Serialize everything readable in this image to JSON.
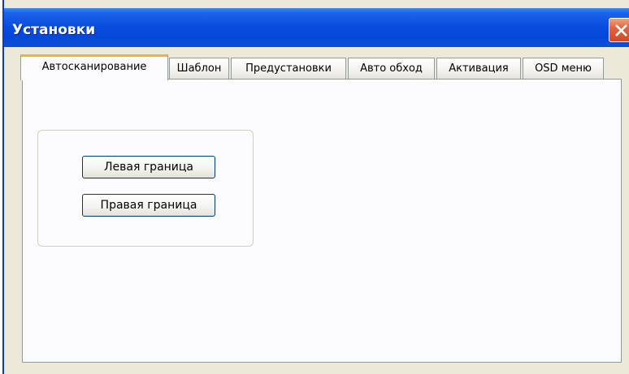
{
  "window": {
    "title": "Установки",
    "accent": "#0a4ee0",
    "close_icon": "close-x"
  },
  "tabs": [
    {
      "label": "Автосканирование",
      "active": true
    },
    {
      "label": "Шаблон",
      "active": false
    },
    {
      "label": "Предустановки",
      "active": false
    },
    {
      "label": "Авто обход",
      "active": false
    },
    {
      "label": "Активация",
      "active": false
    },
    {
      "label": "OSD меню",
      "active": false
    }
  ],
  "autoscan": {
    "left_border_label": "Левая граница",
    "right_border_label": "Правая граница"
  }
}
